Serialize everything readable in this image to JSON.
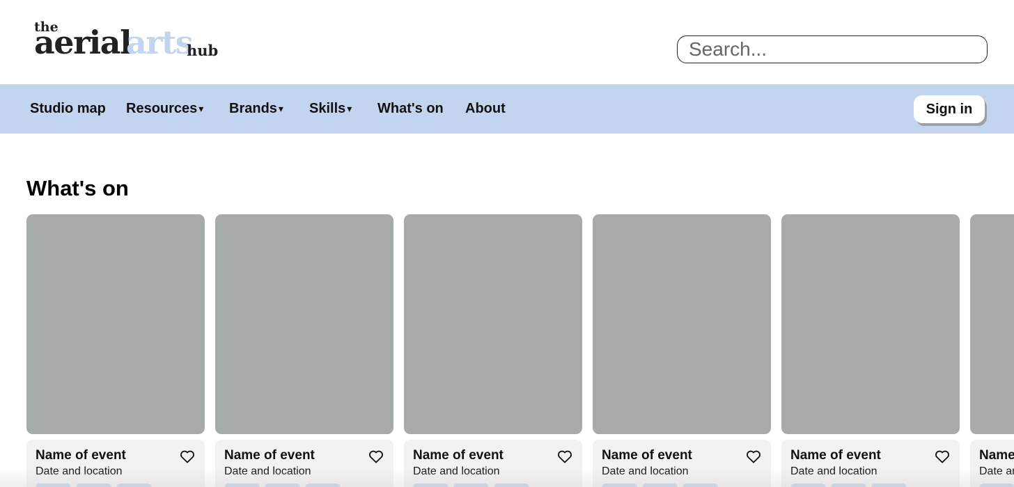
{
  "header": {
    "logo": {
      "the": "the",
      "aerial": "aerial",
      "arts": "arts",
      "hub": "hub"
    },
    "search": {
      "placeholder": "Search..."
    }
  },
  "nav": {
    "items": [
      {
        "label": "Studio map",
        "caret": ""
      },
      {
        "label": "Resources",
        "caret": "▾"
      },
      {
        "label": "Brands",
        "caret": "▾"
      },
      {
        "label": "Skills",
        "caret": "▾"
      },
      {
        "label": "What's on",
        "caret": ""
      },
      {
        "label": "About",
        "caret": ""
      }
    ],
    "signin_label": "Sign in"
  },
  "main": {
    "title": "What's on",
    "cards": [
      {
        "name": "Name of event",
        "date": "Date and location"
      },
      {
        "name": "Name of event",
        "date": "Date and location"
      },
      {
        "name": "Name of event",
        "date": "Date and location"
      },
      {
        "name": "Name of event",
        "date": "Date and location"
      },
      {
        "name": "Name of event",
        "date": "Date and location"
      },
      {
        "name": "Name of event",
        "date": "Date and location"
      }
    ]
  },
  "colors": {
    "nav_background": "#c3d4ee",
    "card_image": "#a7acab",
    "card_body": "#f2f2f2",
    "tag": "#c3d4ee"
  }
}
